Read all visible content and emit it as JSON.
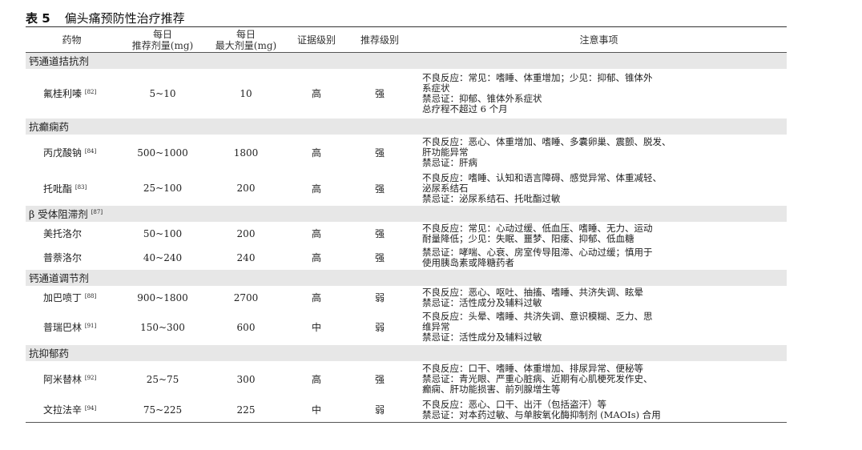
{
  "caption": {
    "number": "表 5",
    "title": "偏头痛预防性治疗推荐"
  },
  "headers": {
    "drug": "药物",
    "rec_dose": [
      "每日",
      "推荐剂量(mg)"
    ],
    "max_dose": [
      "每日",
      "最大剂量(mg)"
    ],
    "evidence": "证据级别",
    "recommendation": "推荐级别",
    "notes": "注意事项"
  },
  "groups": [
    {
      "category": "钙通道拮抗剂",
      "cat_ref": "",
      "rows": [
        {
          "name": "氟桂利嗪",
          "ref": "[82]",
          "rec": "5~10",
          "max": "10",
          "evidence": "高",
          "level": "强",
          "notes": [
            "不良反应：常见：嗜睡、体重增加；少见：抑郁、锥体外",
            "系症状",
            "禁忌证：抑郁、锥体外系症状",
            "总疗程不超过 6 个月"
          ]
        }
      ]
    },
    {
      "category": "抗癫痫药",
      "cat_ref": "",
      "rows": [
        {
          "name": "丙戊酸钠",
          "ref": "[84]",
          "rec": "500~1000",
          "max": "1800",
          "evidence": "高",
          "level": "强",
          "notes": [
            "不良反应：恶心、体重增加、嗜睡、多囊卵巢、震颤、脱发、",
            "肝功能异常",
            "禁忌证：肝病"
          ]
        },
        {
          "name": "托吡酯",
          "ref": "[83]",
          "rec": "25~100",
          "max": "200",
          "evidence": "高",
          "level": "强",
          "notes": [
            "不良反应：嗜睡、认知和语言障碍、感觉异常、体重减轻、",
            "泌尿系结石",
            "禁忌证：泌尿系结石、托吡酯过敏"
          ]
        }
      ]
    },
    {
      "category": "β 受体阻滞剂",
      "cat_ref": "[87]",
      "rows": [
        {
          "name": "美托洛尔",
          "ref": "",
          "rec": "50~100",
          "max": "200",
          "evidence": "高",
          "level": "强",
          "notes": [
            "不良反应：常见：心动过缓、低血压、嗜睡、无力、运动",
            "耐量降低；少见：失眠、噩梦、阳痿、抑郁、低血糖"
          ]
        },
        {
          "name": "普萘洛尔",
          "ref": "",
          "rec": "40~240",
          "max": "240",
          "evidence": "高",
          "level": "强",
          "notes": [
            "禁忌证：哮喘、心衰、房室传导阻滞、心动过缓；慎用于",
            "使用胰岛素或降糖药者"
          ]
        }
      ]
    },
    {
      "category": "钙通道调节剂",
      "cat_ref": "",
      "rows": [
        {
          "name": "加巴喷丁",
          "ref": "[88]",
          "rec": "900~1800",
          "max": "2700",
          "evidence": "高",
          "level": "弱",
          "notes": [
            "不良反应：恶心、呕吐、抽搐、嗜睡、共济失调、眩晕",
            "禁忌证：活性成分及辅料过敏"
          ]
        },
        {
          "name": "普瑞巴林",
          "ref": "[91]",
          "rec": "150~300",
          "max": "600",
          "evidence": "中",
          "level": "弱",
          "notes": [
            "不良反应：头晕、嗜睡、共济失调、意识模糊、乏力、思",
            "维异常",
            "禁忌证：活性成分及辅料过敏"
          ]
        }
      ]
    },
    {
      "category": "抗抑郁药",
      "cat_ref": "",
      "rows": [
        {
          "name": "阿米替林",
          "ref": "[92]",
          "rec": "25~75",
          "max": "300",
          "evidence": "高",
          "level": "强",
          "notes": [
            "不良反应：口干、嗜睡、体重增加、排尿异常、便秘等",
            "禁忌证：青光眼、严重心脏病、近期有心肌梗死发作史、",
            "癫痫、肝功能损害、前列腺增生等"
          ]
        },
        {
          "name": "文拉法辛",
          "ref": "[94]",
          "rec": "75~225",
          "max": "225",
          "evidence": "中",
          "level": "弱",
          "notes": [
            "不良反应：恶心、口干、出汗（包括盗汗）等",
            "禁忌证：对本药过敏、与单胺氧化酶抑制剂 (MAOIs) 合用"
          ]
        }
      ]
    }
  ]
}
